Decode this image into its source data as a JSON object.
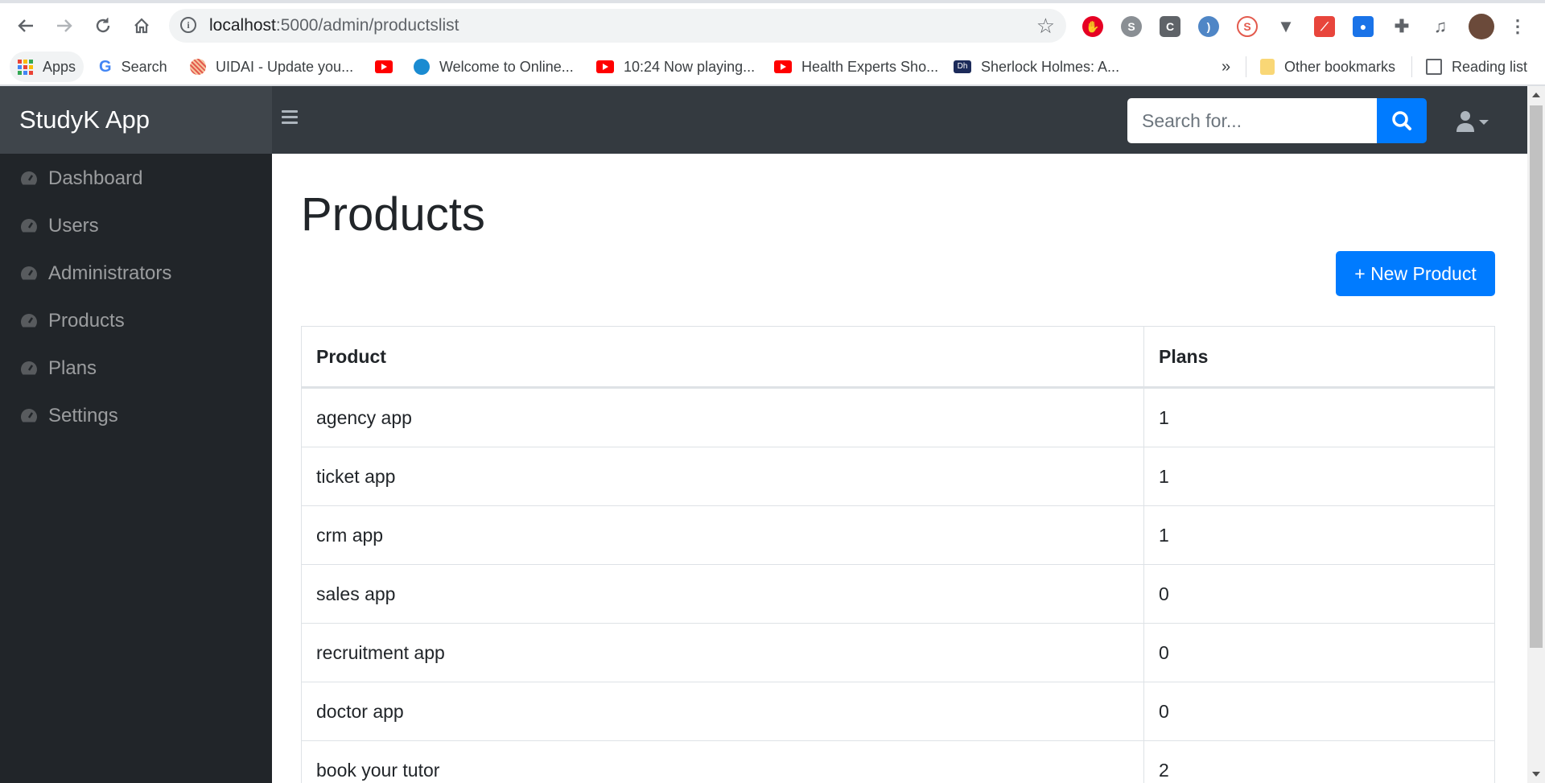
{
  "browser": {
    "url_host": "localhost",
    "url_path": ":5000/admin/productslist",
    "bookmarks": [
      {
        "label": "Apps",
        "icon": "apps-grid-icon"
      },
      {
        "label": "Search",
        "icon": "google-icon"
      },
      {
        "label": "UIDAI - Update you...",
        "icon": "uidai-icon"
      },
      {
        "label": "",
        "icon": "youtube-icon"
      },
      {
        "label": "Welcome to Online...",
        "icon": "sbi-icon"
      },
      {
        "label": "10:24 Now playing...",
        "icon": "youtube-icon"
      },
      {
        "label": "Health Experts Sho...",
        "icon": "youtube-icon"
      },
      {
        "label": "Sherlock Holmes: A...",
        "icon": "dh-icon"
      }
    ],
    "overflow_label": "»",
    "other_bookmarks": "Other bookmarks",
    "reading_list": "Reading list"
  },
  "app": {
    "brand": "StudyK App",
    "search_placeholder": "Search for..."
  },
  "sidebar": {
    "items": [
      {
        "label": "Dashboard"
      },
      {
        "label": "Users"
      },
      {
        "label": "Administrators"
      },
      {
        "label": "Products"
      },
      {
        "label": "Plans"
      },
      {
        "label": "Settings"
      }
    ]
  },
  "main": {
    "title": "Products",
    "new_button": "+ New Product",
    "table": {
      "headers": [
        "Product",
        "Plans"
      ],
      "rows": [
        [
          "agency app",
          "1"
        ],
        [
          "ticket app",
          "1"
        ],
        [
          "crm app",
          "1"
        ],
        [
          "sales app",
          "0"
        ],
        [
          "recruitment app",
          "0"
        ],
        [
          "doctor app",
          "0"
        ],
        [
          "book your tutor",
          "2"
        ]
      ]
    }
  },
  "colors": {
    "primary": "#007bff",
    "navbar": "#343a40",
    "sidebar": "#212529",
    "brand_bg": "#3f454b"
  }
}
